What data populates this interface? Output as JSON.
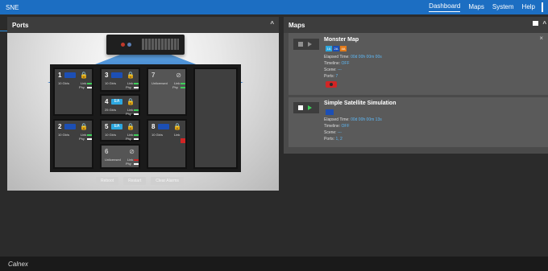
{
  "header": {
    "app_title": "SNE",
    "nav": [
      "Dashboard",
      "Maps",
      "System",
      "Help"
    ]
  },
  "ports_panel": {
    "title": "Ports",
    "buttons": [
      "Reboot",
      "Restart",
      "Clear Alarms"
    ],
    "slots": {
      "s1": {
        "num": "1",
        "speed": "10 Gb/s",
        "link": "Link",
        "phy": "Phy"
      },
      "s2": {
        "num": "2",
        "speed": "10 Gb/s",
        "link": "Link",
        "phy": "Phy"
      },
      "s3": {
        "num": "3",
        "speed": "10 Gb/s",
        "link": "Link",
        "phy": "Phy"
      },
      "s4": {
        "num": "4",
        "badge": "EA",
        "speed": "25 Gb/s",
        "link": "Link",
        "phy": "Phy"
      },
      "s5": {
        "num": "5",
        "badge": "EA",
        "speed": "10 Gb/s",
        "link": "Link",
        "phy": "Phy"
      },
      "s6": {
        "num": "6",
        "speed": "Unlicensed",
        "link": "Link",
        "phy": "Phy"
      },
      "s7": {
        "num": "7",
        "speed": "Unlicensed",
        "link": "Link",
        "phy": "Phy"
      },
      "s8": {
        "num": "8",
        "speed": "10 Gb/s",
        "link": "Link",
        "phy": "Phy"
      }
    }
  },
  "maps_panel": {
    "title": "Maps",
    "cards": [
      {
        "name": "Monster Map",
        "tags": [
          "1A",
          "2A",
          "4A"
        ],
        "elapsed_label": "Elapsed Time:",
        "elapsed_value": "00d 00h 00m 00s",
        "timeline_label": "Timeline:",
        "timeline_value": "OFF",
        "scene_label": "Scene:",
        "scene_value": "---",
        "ports_label": "Ports:",
        "ports_value": "7"
      },
      {
        "name": "Simple Satellite Simulation",
        "elapsed_label": "Elapsed Time:",
        "elapsed_value": "00d 00h 00m 13s",
        "timeline_label": "Timeline:",
        "timeline_value": "OFF",
        "scene_label": "Scene:",
        "scene_value": "---",
        "ports_label": "Ports:",
        "ports_value": "1, 2"
      }
    ]
  },
  "footer": {
    "logo": "Calnex"
  },
  "colors": {
    "accent": "#1c6ec2",
    "link_ok": "#3ecf5a",
    "error": "#d12525"
  }
}
